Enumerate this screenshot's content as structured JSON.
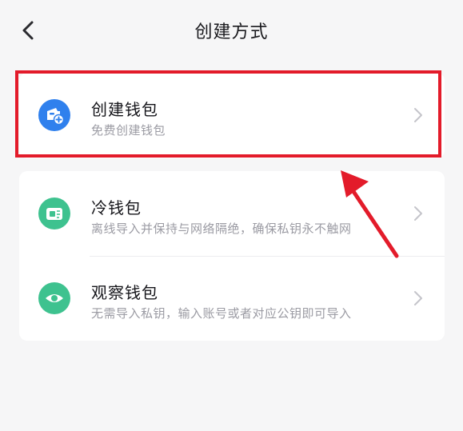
{
  "header": {
    "title": "创建方式",
    "back_icon": "chevron-left-icon"
  },
  "options": [
    {
      "title": "创建钱包",
      "subtitle": "免费创建钱包",
      "icon": "wallet-add-icon",
      "icon_color": "#2f80ed"
    },
    {
      "title": "冷钱包",
      "subtitle": "离线导入并保持与网络隔绝，确保私钥永不触网",
      "icon": "cold-wallet-icon",
      "icon_color": "#3ec28f"
    },
    {
      "title": "观察钱包",
      "subtitle": "无需导入私钥，输入账号或者对应公钥即可导入",
      "icon": "eye-icon",
      "icon_color": "#3ec28f"
    }
  ],
  "annotation": {
    "highlight_color": "#e31b2a"
  }
}
